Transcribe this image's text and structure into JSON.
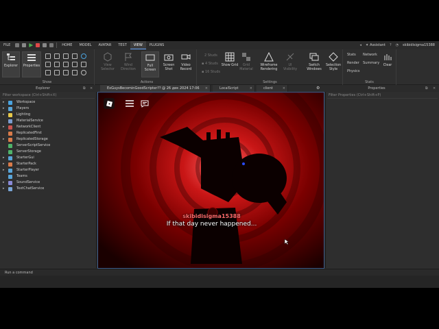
{
  "menubar": {
    "file": "FILE",
    "tabs": [
      "HOME",
      "MODEL",
      "AVATAR",
      "TEST",
      "VIEW",
      "PLUGINS"
    ],
    "active_tab": "VIEW",
    "assistant": "Assistant",
    "username": "skibidisigma15388"
  },
  "ribbon": {
    "show_group": {
      "label": "Show",
      "explorer": "Explorer",
      "properties": "Properties"
    },
    "actions_group": {
      "label": "Actions",
      "view_selector": "View Selector",
      "wind_direction": "Wind Direction",
      "full_screen": "Full Screen",
      "screen_shot": "Screen Shot",
      "video_record": "Video Record"
    },
    "settings_group": {
      "label": "Settings",
      "studs_2": "2 Studs",
      "studs_4": "4 Studs",
      "studs_16": "16 Studs",
      "show_grid": "Show Grid",
      "grid_material": "Grid Material",
      "wireframe_rendering": "Wireframe Rendering",
      "ui_visibility": "UI Visibility",
      "switch_windows": "Switch Windows",
      "selection_style": "Selection Style"
    },
    "stats_group": {
      "label": "Stats",
      "stats": "Stats",
      "network": "Network",
      "render": "Render",
      "summary": "Summary",
      "physics": "Physics",
      "clear": "Clear"
    }
  },
  "explorer": {
    "title": "Explorer",
    "filter_placeholder": "Filter workspace (Ctrl+Shift+X)",
    "items": [
      {
        "label": "Workspace",
        "expandable": true,
        "color": "#4aa3df"
      },
      {
        "label": "Players",
        "expandable": true,
        "color": "#5aa5d8"
      },
      {
        "label": "Lighting",
        "expandable": true,
        "color": "#e6c84a"
      },
      {
        "label": "MaterialService",
        "expandable": false,
        "color": "#7b9ccf"
      },
      {
        "label": "NetworkClient",
        "expandable": true,
        "color": "#c9534f"
      },
      {
        "label": "ReplicatedFirst",
        "expandable": false,
        "color": "#d97b4a"
      },
      {
        "label": "ReplicatedStorage",
        "expandable": true,
        "color": "#d97b4a"
      },
      {
        "label": "ServerScriptService",
        "expandable": false,
        "color": "#4fb36a"
      },
      {
        "label": "ServerStorage",
        "expandable": false,
        "color": "#4fb36a"
      },
      {
        "label": "StarterGui",
        "expandable": true,
        "color": "#5aa5d8"
      },
      {
        "label": "StarterPack",
        "expandable": true,
        "color": "#d97b4a"
      },
      {
        "label": "StarterPlayer",
        "expandable": true,
        "color": "#5aa5d8"
      },
      {
        "label": "Teams",
        "expandable": false,
        "color": "#5aa5d8"
      },
      {
        "label": "SoundService",
        "expandable": true,
        "color": "#8a8ad6"
      },
      {
        "label": "TextChatService",
        "expandable": true,
        "color": "#7aa6d6"
      }
    ]
  },
  "editor_tabs": [
    {
      "label": "ExGuysBecominGoodScripter?? @ 26 дек 2024 17:06",
      "active": true
    },
    {
      "label": "LocalScript",
      "active": false
    },
    {
      "label": "client",
      "active": false
    }
  ],
  "properties": {
    "title": "Properties",
    "filter_placeholder": "Filter Properties (Ctrl+Shift+P)"
  },
  "viewport": {
    "chat_name": "skibidisigma15388",
    "chat_message": "If that day never happened..."
  },
  "command_bar": {
    "placeholder": "Run a command"
  }
}
